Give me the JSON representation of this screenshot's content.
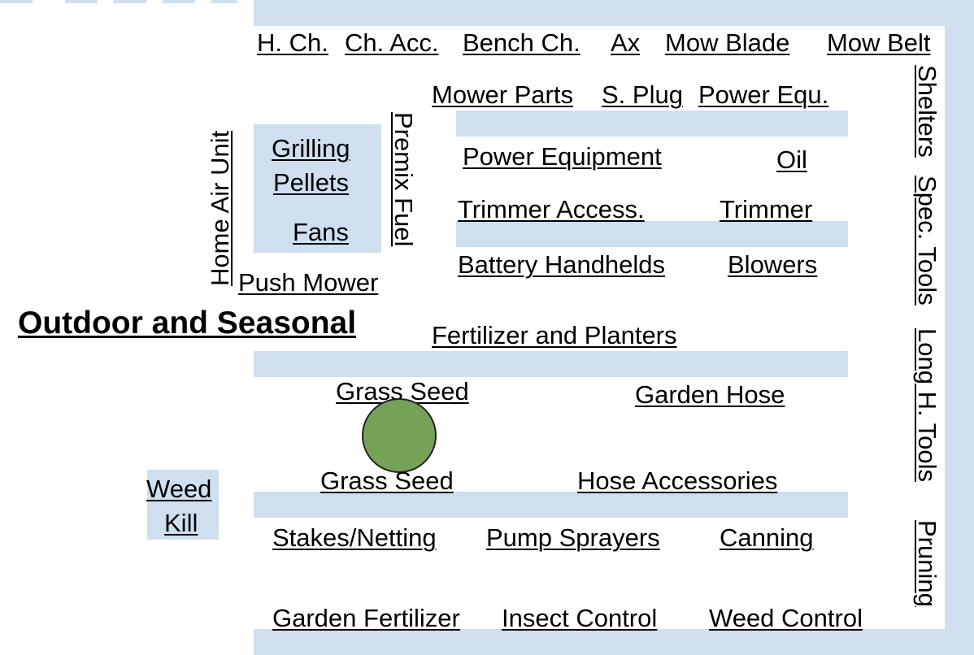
{
  "title": "Outdoor and Seasonal",
  "labels": {
    "h_ch": "H. Ch.",
    "ch_acc": "Ch. Acc.",
    "bench_ch": "Bench Ch.",
    "ax": "Ax",
    "mow_blade": "Mow Blade",
    "mow_belt": "Mow Belt",
    "mower_parts": "Mower Parts",
    "s_plug": "S. Plug",
    "power_equ": "Power Equ.",
    "grilling": "Grilling",
    "pellets": "Pellets",
    "fans": "Fans",
    "push_mower": "Push Mower",
    "power_equipment": "Power Equipment",
    "oil": "Oil",
    "trimmer_access": "Trimmer Access.",
    "trimmer": "Trimmer",
    "battery_handhelds": "Battery Handhelds",
    "blowers": "Blowers",
    "fertilizer_planters": "Fertilizer and Planters",
    "grass_seed_1": "Grass Seed",
    "garden_hose": "Garden Hose",
    "weed": "Weed",
    "kill": "Kill",
    "grass_seed_2": "Grass Seed",
    "hose_accessories": "Hose Accessories",
    "stakes_netting": "Stakes/Netting",
    "pump_sprayers": "Pump Sprayers",
    "canning": "Canning",
    "garden_fertilizer": "Garden Fertilizer",
    "insect_control": "Insect Control",
    "weed_control": "Weed Control",
    "home_air_unit": "Home Air Unit",
    "premix_fuel": "Premix Fuel",
    "shelters": "Shelters",
    "spec_tools": "Spec. Tools",
    "long_h_tools": "Long H. Tools",
    "pruning": "Pruning"
  },
  "colors": {
    "shelf": "#cfdff0",
    "marker": "#76a257"
  }
}
